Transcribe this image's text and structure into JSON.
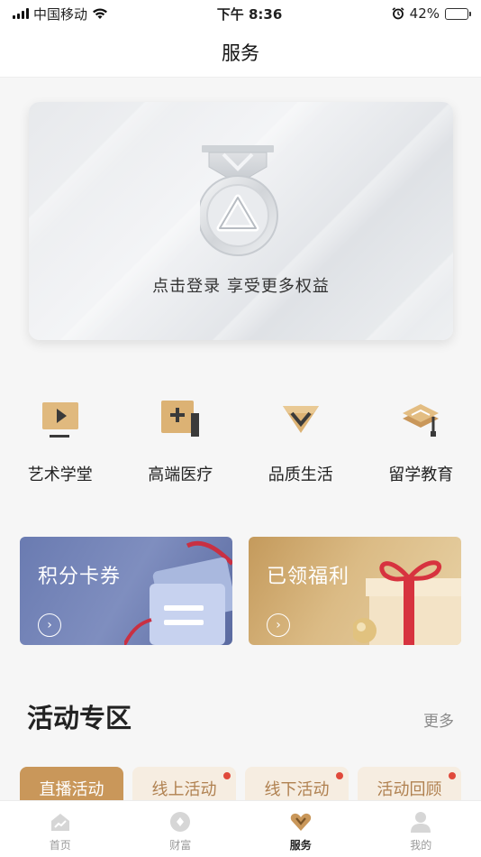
{
  "status_bar": {
    "carrier": "中国移动",
    "time": "下午 8:36",
    "battery": "42%",
    "battery_level": 0.42
  },
  "nav": {
    "title": "服务"
  },
  "login_card": {
    "prompt": "点击登录 享受更多权益"
  },
  "services": [
    {
      "label": "艺术学堂",
      "icon": "play-screen-icon"
    },
    {
      "label": "高端医疗",
      "icon": "medical-plus-icon"
    },
    {
      "label": "品质生活",
      "icon": "diamond-v-icon"
    },
    {
      "label": "留学教育",
      "icon": "graduation-cap-icon"
    }
  ],
  "promos": [
    {
      "title": "积分卡券",
      "icon": "chevron-right-icon"
    },
    {
      "title": "已领福利",
      "icon": "chevron-right-icon"
    }
  ],
  "activity": {
    "title": "活动专区",
    "more": "更多",
    "tabs": [
      {
        "label": "直播活动",
        "active": true,
        "dot": false
      },
      {
        "label": "线上活动",
        "active": false,
        "dot": true
      },
      {
        "label": "线下活动",
        "active": false,
        "dot": true
      },
      {
        "label": "活动回顾",
        "active": false,
        "dot": true
      }
    ]
  },
  "tab_bar": [
    {
      "label": "首页",
      "icon": "home-chart-icon",
      "active": false
    },
    {
      "label": "财富",
      "icon": "wealth-coin-icon",
      "active": false
    },
    {
      "label": "服务",
      "icon": "service-heart-icon",
      "active": true
    },
    {
      "label": "我的",
      "icon": "user-icon",
      "active": false
    }
  ],
  "colors": {
    "accent": "#c9975a",
    "accent_light": "#f6ede1",
    "badge": "#e0493b",
    "points_card": "#6a7bb1",
    "benefits_card": "#d4b07a"
  }
}
